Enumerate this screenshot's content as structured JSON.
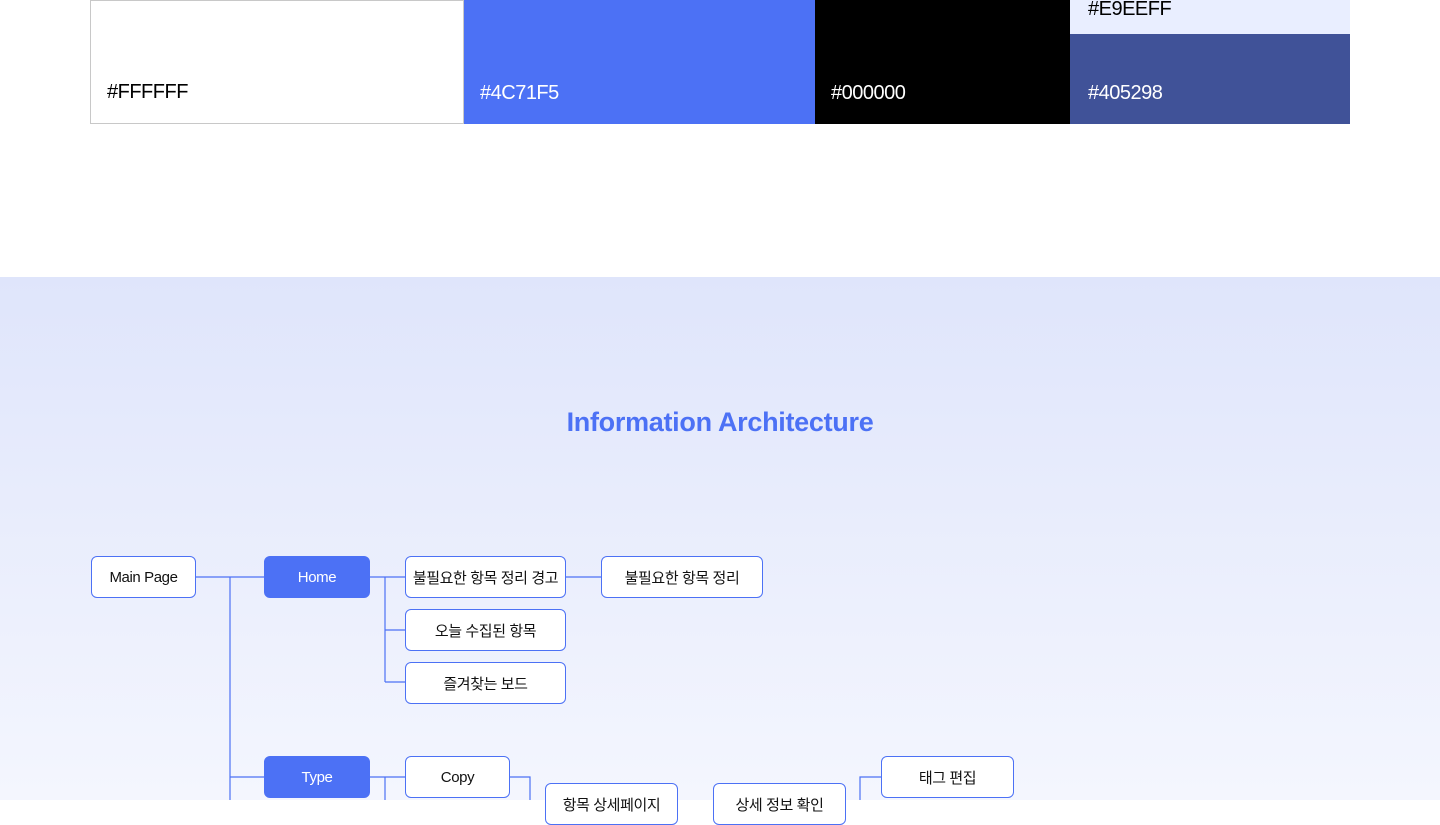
{
  "palette": {
    "white": "#FFFFFF",
    "blue": "#4C71F5",
    "black": "#000000",
    "light": "#E9EEFF",
    "navy": "#405298"
  },
  "ia": {
    "title": "Information Architecture",
    "nodes": {
      "main": "Main Page",
      "home": "Home",
      "warn": "불필요한 항목 정리 경고",
      "cleanup": "불필요한 항목 정리",
      "today": "오늘 수집된 항목",
      "favorites": "즐겨찾는 보드",
      "type": "Type",
      "copy": "Copy",
      "detail": "항목 상세페이지",
      "check": "상세 정보 확인",
      "tagedit": "태그 편집"
    }
  }
}
